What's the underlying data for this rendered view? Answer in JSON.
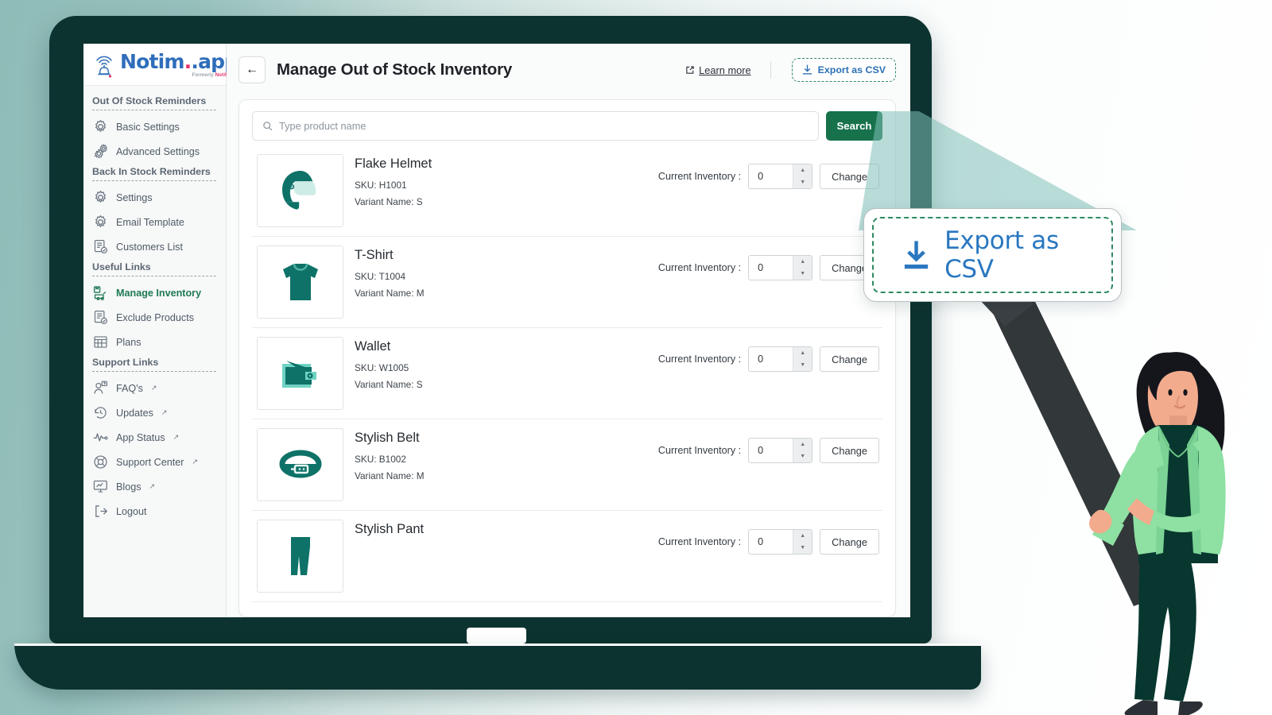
{
  "brand": {
    "name": "Notim",
    "suffix": ".app",
    "tagline_prefix": "Formerly ",
    "tagline_brand": "Notify Me",
    "logo_icon": "bell-signal-icon",
    "primary_color": "#2f6dbb",
    "accent_color": "#e4336a"
  },
  "sidebar": {
    "sections": [
      {
        "title": "Out Of Stock Reminders",
        "items": [
          {
            "label": "Basic Settings",
            "icon": "gear-icon",
            "active": false,
            "external": false
          },
          {
            "label": "Advanced Settings",
            "icon": "double-gear-icon",
            "active": false,
            "external": false
          }
        ]
      },
      {
        "title": "Back In Stock Reminders",
        "items": [
          {
            "label": "Settings",
            "icon": "gear-icon",
            "active": false,
            "external": false
          },
          {
            "label": "Email Template",
            "icon": "gear-icon",
            "active": false,
            "external": false
          },
          {
            "label": "Customers List",
            "icon": "list-check-icon",
            "active": false,
            "external": false
          }
        ]
      },
      {
        "title": "Useful Links",
        "items": [
          {
            "label": "Manage Inventory",
            "icon": "inventory-cart-icon",
            "active": true,
            "external": false
          },
          {
            "label": "Exclude Products",
            "icon": "list-check-icon",
            "active": false,
            "external": false
          },
          {
            "label": "Plans",
            "icon": "grid-table-icon",
            "active": false,
            "external": false
          }
        ]
      },
      {
        "title": "Support Links",
        "items": [
          {
            "label": "FAQ's",
            "icon": "user-question-icon",
            "active": false,
            "external": true
          },
          {
            "label": "Updates",
            "icon": "history-icon",
            "active": false,
            "external": true
          },
          {
            "label": "App Status",
            "icon": "pulse-icon",
            "active": false,
            "external": true
          },
          {
            "label": "Support Center",
            "icon": "lifebuoy-icon",
            "active": false,
            "external": true
          },
          {
            "label": "Blogs",
            "icon": "monitor-edit-icon",
            "active": false,
            "external": true
          },
          {
            "label": "Logout",
            "icon": "logout-icon",
            "active": false,
            "external": false
          }
        ]
      }
    ],
    "external_glyph": "↗"
  },
  "header": {
    "back_icon": "arrow-left-icon",
    "back_glyph": "←",
    "title": "Manage Out of Stock Inventory",
    "learn_more_label": "Learn more",
    "learn_more_icon": "external-link-icon",
    "export_label": "Export as CSV",
    "export_icon": "download-icon",
    "export_border_color": "#2f8a62",
    "export_text_color": "#2a6fb5"
  },
  "search": {
    "placeholder": "Type product name",
    "value": "",
    "icon": "search-icon",
    "button_label": "Search",
    "button_color": "#17724c"
  },
  "inventory": {
    "inventory_label": "Current Inventory :",
    "change_label": "Change",
    "stepper_up_glyph": "▲",
    "stepper_down_glyph": "▼",
    "products": [
      {
        "name": "Flake Helmet",
        "sku_label": "SKU: H1001",
        "variant_label": "Variant Name: S",
        "quantity": "0",
        "icon": "helmet-icon"
      },
      {
        "name": "T-Shirt",
        "sku_label": "SKU: T1004",
        "variant_label": "Variant Name: M",
        "quantity": "0",
        "icon": "tshirt-icon"
      },
      {
        "name": "Wallet",
        "sku_label": "SKU: W1005",
        "variant_label": "Variant Name: S",
        "quantity": "0",
        "icon": "wallet-icon"
      },
      {
        "name": "Stylish Belt",
        "sku_label": "SKU: B1002",
        "variant_label": "Variant Name: M",
        "quantity": "0",
        "icon": "belt-icon"
      },
      {
        "name": "Stylish Pant",
        "sku_label": "",
        "variant_label": "",
        "quantity": "0",
        "icon": "pant-icon"
      }
    ]
  },
  "callout": {
    "label": "Export as CSV",
    "icon": "download-icon",
    "border_color": "#2f8a62",
    "text_color": "#2a77c0"
  },
  "illustration": {
    "person": "woman-holding-magnifier",
    "magnifier": "magnifying-glass-handle"
  }
}
